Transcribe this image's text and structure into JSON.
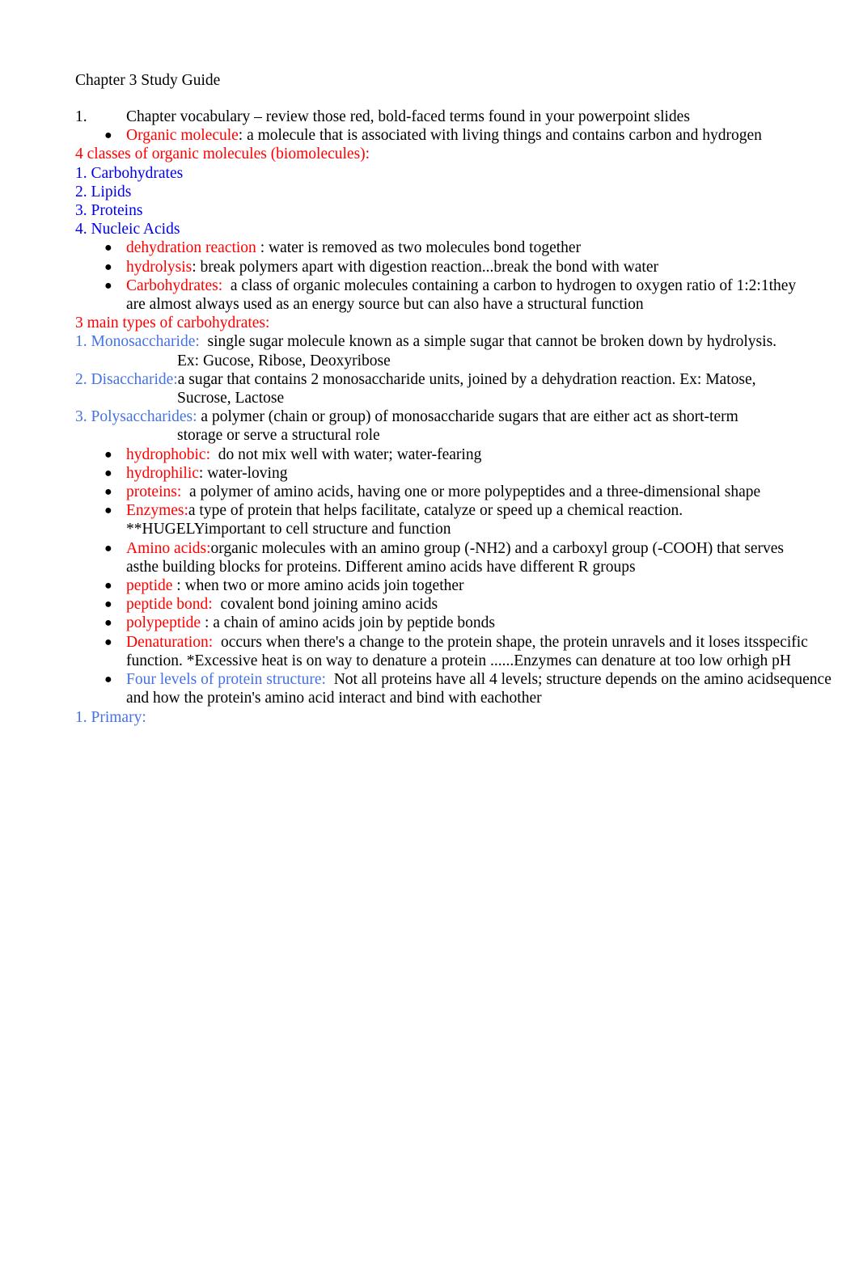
{
  "document": {
    "title": "Chapter 3 Study Guide",
    "colors": {
      "red": "#ff0000",
      "blue": "#0000ee",
      "royal_blue": "#4472e4",
      "black": "#000000",
      "page_background": "#ffffff"
    }
  },
  "outline": {
    "item1_number": "1.",
    "item1_text": "Chapter vocabulary – review those red, bold-faced terms found in your powerpoint slides",
    "organic_molecule_term": "Organic molecule",
    "organic_molecule_def": ": a molecule that is associated with living things and contains carbon and hydrogen"
  },
  "classes_section": {
    "heading": "4 classes of organic molecules (biomolecules):",
    "items": [
      "1. Carbohydrates",
      "2. Lipids",
      "3. Proteins",
      "4. Nucleic Acids"
    ]
  },
  "reaction_bullets": [
    {
      "term": "dehydration reaction ",
      "def": ": water is removed as two molecules bond together"
    },
    {
      "term": "hydrolysis",
      "def": ": break polymers apart with digestion reaction...break the bond with water"
    },
    {
      "term": "Carbohydrates: ",
      "def": " a class of organic molecules containing a carbon to hydrogen to oxygen ratio of 1:2:1",
      "def_line2": "they are almost always used as an energy source but can also have a structural function"
    }
  ],
  "carb_section": {
    "heading": "3 main types of carbohydrates:",
    "items": [
      {
        "label": "1. Monosaccharide: ",
        "def": " single sugar molecule known as a simple sugar that cannot be broken down by hydrolysis.",
        "def_line2": "Ex: Gucose, Ribose, Deoxyribose"
      },
      {
        "label": "2. Disaccharide:",
        "def": "a sugar that contains 2 monosaccharide units, joined by a dehydration reaction. Ex: Matose,",
        "def_line2": "Sucrose, Lactose"
      },
      {
        "label": "3. Polysaccharides: ",
        "def": "a polymer (chain or group) of monosaccharide sugars that are either act as short-term",
        "def_line2": "storage or serve a structural role"
      }
    ]
  },
  "protein_bullets": [
    {
      "term": "hydrophobic: ",
      "def": " do not mix well with water; water-fearing",
      "color": "red"
    },
    {
      "term": "hydrophilic",
      "def": ": water-loving",
      "color": "red"
    },
    {
      "term": "proteins: ",
      "def": " a polymer of amino acids, having one or more polypeptides and a three-dimensional shape",
      "color": "red"
    },
    {
      "term": "Enzymes:",
      "def": "a type of protein that helps facilitate, catalyze or speed up a chemical reaction. **HUGELY",
      "def_line2": "important to cell structure and function",
      "color": "red"
    },
    {
      "term": "Amino acids:",
      "def": "organic molecules with an amino group (-NH2) and a carboxyl group (-COOH) that serves as",
      "def_line2": "the building blocks for proteins. Different amino acids have different R groups",
      "color": "red"
    },
    {
      "term": "peptide ",
      "def": ": when two or more amino acids join together",
      "color": "red"
    },
    {
      "term": "peptide bond: ",
      "def": " covalent bond joining amino acids",
      "color": "red"
    },
    {
      "term": "polypeptide ",
      "def": ": a chain of amino acids join by peptide bonds",
      "color": "red"
    },
    {
      "term": "Denaturation: ",
      "def": " occurs when there's a change to the protein shape, the protein unravels and it loses its",
      "def_line2": "specific function. *Excessive heat is on way to denature a protein ......Enzymes can denature at too low or",
      "def_line3": "high pH",
      "color": "red"
    },
    {
      "term": "Four levels of protein structure: ",
      "def": " Not all proteins have all 4 levels; structure depends on the amino acid",
      "def_line2": "sequence and how the protein's amino acid interact and bind with eachother",
      "color": "royal"
    }
  ],
  "final_line": {
    "text": "1. Primary:"
  }
}
